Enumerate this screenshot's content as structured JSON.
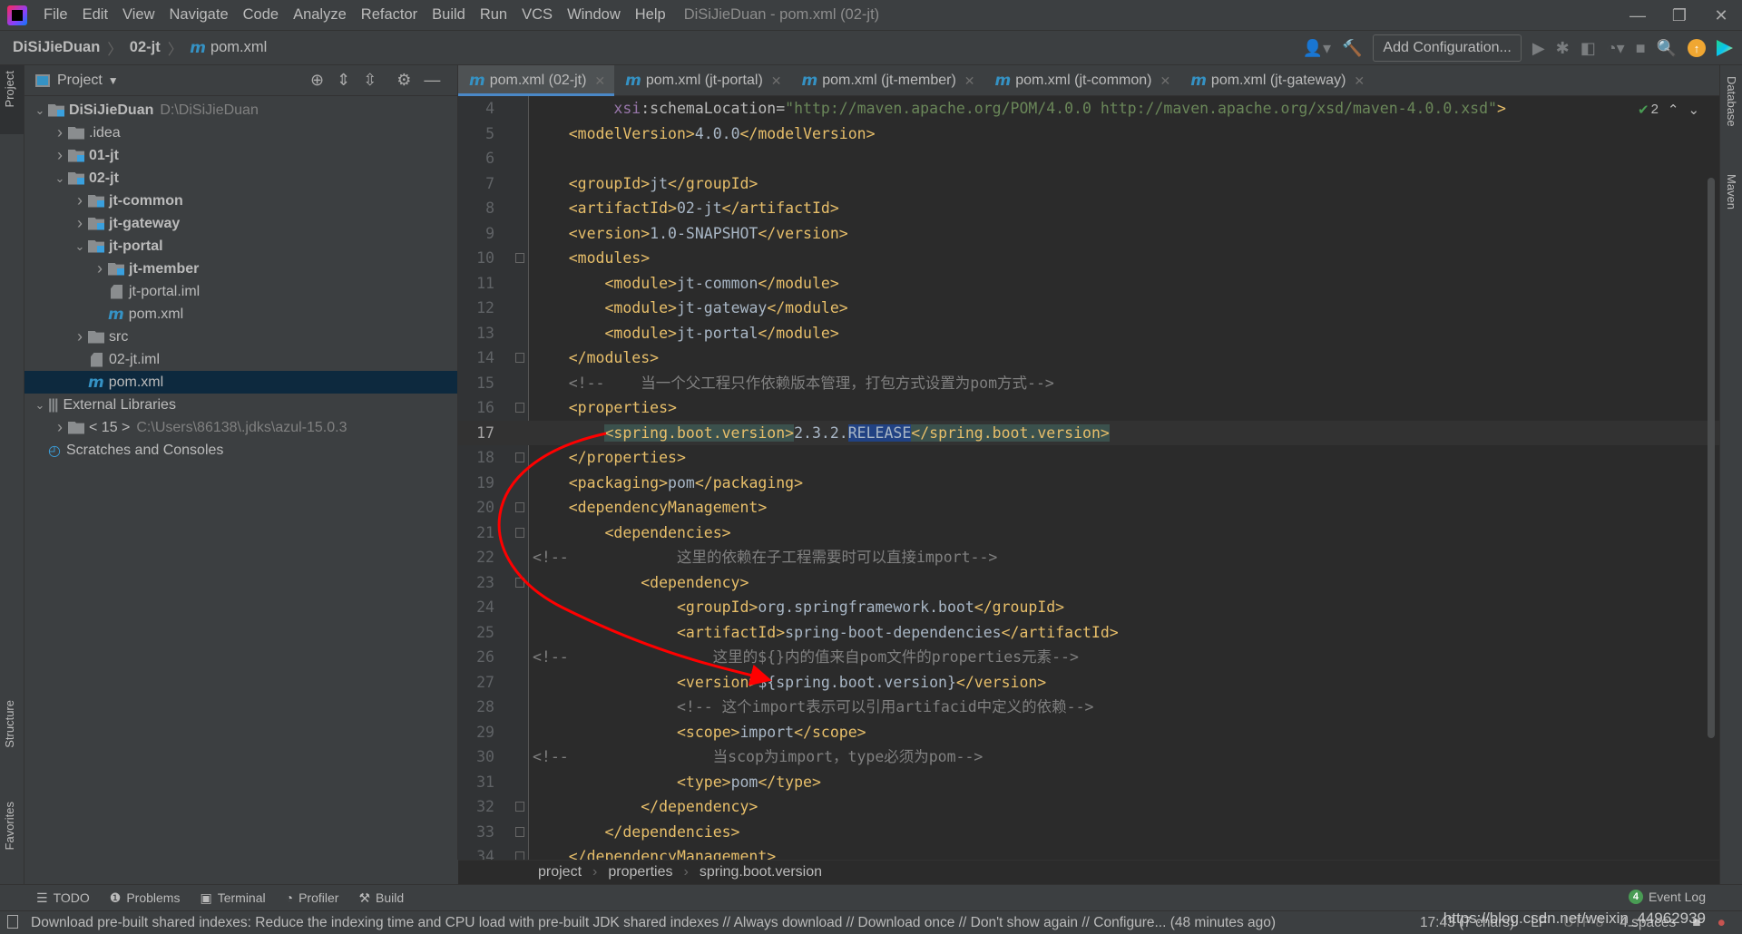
{
  "menubar": {
    "items": [
      "File",
      "Edit",
      "View",
      "Navigate",
      "Code",
      "Analyze",
      "Refactor",
      "Build",
      "Run",
      "VCS",
      "Window",
      "Help"
    ],
    "title": "DiSiJieDuan - pom.xml (02-jt)"
  },
  "navbar": {
    "crumbs": [
      "DiSiJieDuan",
      "02-jt",
      "pom.xml"
    ],
    "add_configuration": "Add Configuration..."
  },
  "left_stripe": {
    "project": "Project",
    "structure": "Structure",
    "favorites": "Favorites"
  },
  "right_stripe": {
    "database": "Database",
    "maven": "Maven"
  },
  "project": {
    "title": "Project",
    "tree": [
      {
        "label": "DiSiJieDuan",
        "extra": "D:\\DiSiJieDuan",
        "depth": 0,
        "chev": "down",
        "icon": "module-folder",
        "bold": true
      },
      {
        "label": ".idea",
        "depth": 1,
        "chev": "right",
        "icon": "folder"
      },
      {
        "label": "01-jt",
        "depth": 1,
        "chev": "right",
        "icon": "module-folder",
        "bold": true
      },
      {
        "label": "02-jt",
        "depth": 1,
        "chev": "down",
        "icon": "module-folder",
        "bold": true
      },
      {
        "label": "jt-common",
        "depth": 2,
        "chev": "right",
        "icon": "module-folder",
        "bold": true
      },
      {
        "label": "jt-gateway",
        "depth": 2,
        "chev": "right",
        "icon": "module-folder",
        "bold": true
      },
      {
        "label": "jt-portal",
        "depth": 2,
        "chev": "down",
        "icon": "module-folder",
        "bold": true
      },
      {
        "label": "jt-member",
        "depth": 3,
        "chev": "right",
        "icon": "module-folder",
        "bold": true
      },
      {
        "label": "jt-portal.iml",
        "depth": 3,
        "icon": "iml-file"
      },
      {
        "label": "pom.xml",
        "depth": 3,
        "icon": "maven"
      },
      {
        "label": "src",
        "depth": 2,
        "chev": "right",
        "icon": "folder"
      },
      {
        "label": "02-jt.iml",
        "depth": 2,
        "icon": "iml-file"
      },
      {
        "label": "pom.xml",
        "depth": 2,
        "icon": "maven",
        "selected": true
      },
      {
        "label": "External Libraries",
        "depth": 0,
        "chev": "down",
        "icon": "libraries"
      },
      {
        "label": "< 15 >",
        "extra": "C:\\Users\\86138\\.jdks\\azul-15.0.3",
        "depth": 1,
        "chev": "right",
        "icon": "jdk-folder"
      },
      {
        "label": "Scratches and Consoles",
        "depth": 0,
        "icon": "scratches"
      }
    ]
  },
  "tabs": [
    {
      "label": "pom.xml (02-jt)",
      "active": true
    },
    {
      "label": "pom.xml (jt-portal)"
    },
    {
      "label": "pom.xml (jt-member)"
    },
    {
      "label": "pom.xml (jt-common)"
    },
    {
      "label": "pom.xml (jt-gateway)"
    }
  ],
  "editor": {
    "inspection_count": "2",
    "current_line": 17,
    "lines": [
      {
        "n": 4,
        "seg": [
          [
            "txt",
            "         "
          ],
          [
            "attr",
            "xsi"
          ],
          [
            "punc",
            ":schemaLocation="
          ],
          [
            "str",
            "\"http://maven.apache.org/POM/4.0.0 http://maven.apache.org/xsd/maven-4.0.0.xsd\""
          ],
          [
            "tag",
            ">"
          ]
        ]
      },
      {
        "n": 5,
        "seg": [
          [
            "txt",
            "    "
          ],
          [
            "tag",
            "<modelVersion>"
          ],
          [
            "txt",
            "4.0.0"
          ],
          [
            "tag",
            "</modelVersion>"
          ]
        ]
      },
      {
        "n": 6,
        "seg": []
      },
      {
        "n": 7,
        "seg": [
          [
            "txt",
            "    "
          ],
          [
            "tag",
            "<groupId>"
          ],
          [
            "txt",
            "jt"
          ],
          [
            "tag",
            "</groupId>"
          ]
        ]
      },
      {
        "n": 8,
        "seg": [
          [
            "txt",
            "    "
          ],
          [
            "tag",
            "<artifactId>"
          ],
          [
            "txt",
            "02-jt"
          ],
          [
            "tag",
            "</artifactId>"
          ]
        ]
      },
      {
        "n": 9,
        "seg": [
          [
            "txt",
            "    "
          ],
          [
            "tag",
            "<version>"
          ],
          [
            "txt",
            "1.0-SNAPSHOT"
          ],
          [
            "tag",
            "</version>"
          ]
        ]
      },
      {
        "n": 10,
        "fold": true,
        "seg": [
          [
            "txt",
            "    "
          ],
          [
            "tag",
            "<modules>"
          ]
        ]
      },
      {
        "n": 11,
        "seg": [
          [
            "txt",
            "        "
          ],
          [
            "tag",
            "<module>"
          ],
          [
            "txt",
            "jt-common"
          ],
          [
            "tag",
            "</module>"
          ]
        ]
      },
      {
        "n": 12,
        "seg": [
          [
            "txt",
            "        "
          ],
          [
            "tag",
            "<module>"
          ],
          [
            "txt",
            "jt-gateway"
          ],
          [
            "tag",
            "</module>"
          ]
        ]
      },
      {
        "n": 13,
        "seg": [
          [
            "txt",
            "        "
          ],
          [
            "tag",
            "<module>"
          ],
          [
            "txt",
            "jt-portal"
          ],
          [
            "tag",
            "</module>"
          ]
        ]
      },
      {
        "n": 14,
        "fold": true,
        "seg": [
          [
            "txt",
            "    "
          ],
          [
            "tag",
            "</modules>"
          ]
        ]
      },
      {
        "n": 15,
        "seg": [
          [
            "txt",
            "    "
          ],
          [
            "com",
            "<!--    当一个父工程只作依赖版本管理，打包方式设置为pom方式-->"
          ]
        ]
      },
      {
        "n": 16,
        "fold": true,
        "seg": [
          [
            "txt",
            "    "
          ],
          [
            "tag",
            "<properties>"
          ]
        ]
      },
      {
        "n": 17,
        "seg": [
          [
            "txt",
            "        "
          ],
          [
            "tag hl",
            "<spring.boot.version>"
          ],
          [
            "txt",
            "2.3.2."
          ],
          [
            "txt selr",
            "RELEASE"
          ],
          [
            "tag hl",
            "</spring.boot.version>"
          ]
        ]
      },
      {
        "n": 18,
        "fold": true,
        "seg": [
          [
            "txt",
            "    "
          ],
          [
            "tag",
            "</properties>"
          ]
        ]
      },
      {
        "n": 19,
        "seg": [
          [
            "txt",
            "    "
          ],
          [
            "tag",
            "<packaging>"
          ],
          [
            "txt",
            "pom"
          ],
          [
            "tag",
            "</packaging>"
          ]
        ]
      },
      {
        "n": 20,
        "fold": true,
        "seg": [
          [
            "txt",
            "    "
          ],
          [
            "tag",
            "<dependencyManagement>"
          ]
        ]
      },
      {
        "n": 21,
        "fold": true,
        "seg": [
          [
            "txt",
            "        "
          ],
          [
            "tag",
            "<dependencies>"
          ]
        ]
      },
      {
        "n": 22,
        "seg": [
          [
            "com",
            "<!--            这里的依赖在子工程需要时可以直接import-->"
          ]
        ]
      },
      {
        "n": 23,
        "fold": true,
        "seg": [
          [
            "txt",
            "            "
          ],
          [
            "tag",
            "<dependency>"
          ]
        ]
      },
      {
        "n": 24,
        "seg": [
          [
            "txt",
            "                "
          ],
          [
            "tag",
            "<groupId>"
          ],
          [
            "txt",
            "org.springframework.boot"
          ],
          [
            "tag",
            "</groupId>"
          ]
        ]
      },
      {
        "n": 25,
        "seg": [
          [
            "txt",
            "                "
          ],
          [
            "tag",
            "<artifactId>"
          ],
          [
            "txt",
            "spring-boot-dependencies"
          ],
          [
            "tag",
            "</artifactId>"
          ]
        ]
      },
      {
        "n": 26,
        "seg": [
          [
            "com",
            "<!--                这里的${}内的值来自pom文件的properties元素-->"
          ]
        ]
      },
      {
        "n": 27,
        "seg": [
          [
            "txt",
            "                "
          ],
          [
            "tag",
            "<version>"
          ],
          [
            "txt",
            "${spring.boot.version}"
          ],
          [
            "tag",
            "</version>"
          ]
        ]
      },
      {
        "n": 28,
        "seg": [
          [
            "txt",
            "                "
          ],
          [
            "com",
            "<!-- 这个import表示可以引用artifacid中定义的依赖-->"
          ]
        ]
      },
      {
        "n": 29,
        "seg": [
          [
            "txt",
            "                "
          ],
          [
            "tag",
            "<scope>"
          ],
          [
            "txt",
            "import"
          ],
          [
            "tag",
            "</scope>"
          ]
        ]
      },
      {
        "n": 30,
        "seg": [
          [
            "com",
            "<!--                当scop为import，type必须为pom-->"
          ]
        ]
      },
      {
        "n": 31,
        "seg": [
          [
            "txt",
            "                "
          ],
          [
            "tag",
            "<type>"
          ],
          [
            "txt",
            "pom"
          ],
          [
            "tag",
            "</type>"
          ]
        ]
      },
      {
        "n": 32,
        "fold": true,
        "seg": [
          [
            "txt",
            "            "
          ],
          [
            "tag",
            "</dependency>"
          ]
        ]
      },
      {
        "n": 33,
        "fold": true,
        "seg": [
          [
            "txt",
            "        "
          ],
          [
            "tag",
            "</dependencies>"
          ]
        ]
      },
      {
        "n": 34,
        "fold": true,
        "seg": [
          [
            "txt",
            "    "
          ],
          [
            "tag",
            "</dependencyManagement>"
          ]
        ]
      }
    ]
  },
  "breadcrumb": [
    "project",
    "properties",
    "spring.boot.version"
  ],
  "toolwindows": [
    "TODO",
    "Problems",
    "Terminal",
    "Profiler",
    "Build"
  ],
  "event_log": {
    "label": "Event Log",
    "count": "4"
  },
  "status": {
    "message": "Download pre-built shared indexes: Reduce the indexing time and CPU load with pre-built JDK shared indexes // Always download // Download once // Don't show again // Configure... (48 minutes ago)",
    "position": "17:43 (7 chars)",
    "line_sep": "LF",
    "encoding": "UTF-8",
    "indent": "4 spaces",
    "watermark": "https://blog.csdn.net/weixin_44962939"
  },
  "colors": {
    "accent": "#4a88c7",
    "tag": "#e8bf6a",
    "string": "#6a8759",
    "comment": "#808080",
    "annotation_arrow": "#ff0000"
  }
}
